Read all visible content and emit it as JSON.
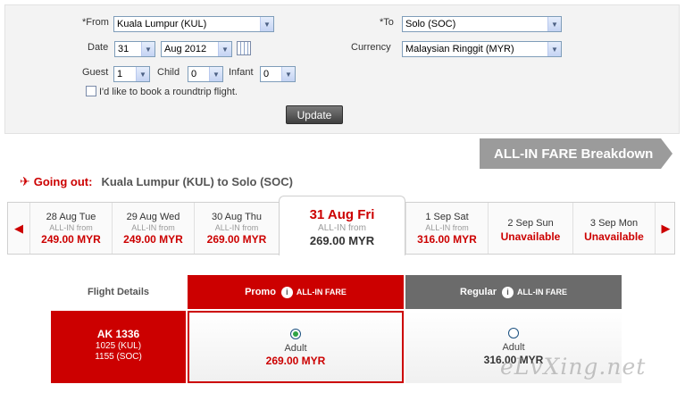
{
  "search": {
    "from_label": "*From",
    "from_value": "Kuala Lumpur (KUL)",
    "to_label": "*To",
    "to_value": "Solo (SOC)",
    "date_label": "Date",
    "date_day": "31",
    "date_month": "Aug 2012",
    "currency_label": "Currency",
    "currency_value": "Malaysian Ringgit (MYR)",
    "guest_label": "Guest",
    "guest_value": "1",
    "child_label": "Child",
    "child_value": "0",
    "infant_label": "Infant",
    "infant_value": "0",
    "roundtrip_label": "I'd like to book a roundtrip flight.",
    "update_label": "Update"
  },
  "breakdown_label": "ALL-IN FARE Breakdown",
  "going_out": {
    "label": "Going out:",
    "route": "Kuala Lumpur (KUL)  to  Solo (SOC)"
  },
  "dates": [
    {
      "date": "28 Aug Tue",
      "sub": "ALL-IN from",
      "price": "249.00 MYR"
    },
    {
      "date": "29 Aug Wed",
      "sub": "ALL-IN from",
      "price": "249.00 MYR"
    },
    {
      "date": "30 Aug Thu",
      "sub": "ALL-IN from",
      "price": "269.00 MYR"
    },
    {
      "date": "31 Aug Fri",
      "sub": "ALL-IN from",
      "price": "269.00 MYR"
    },
    {
      "date": "1 Sep Sat",
      "sub": "ALL-IN from",
      "price": "316.00 MYR"
    },
    {
      "date": "2 Sep Sun",
      "status": "Unavailable"
    },
    {
      "date": "3 Sep Mon",
      "status": "Unavailable"
    }
  ],
  "fares": {
    "flight_details_label": "Flight Details",
    "promo_title": "Promo",
    "promo_sub": "ALL-IN FARE",
    "regular_title": "Regular",
    "regular_sub": "ALL-IN FARE",
    "flight_no": "AK 1336",
    "depart": "1025 (KUL)",
    "arrive": "1155 (SOC)",
    "promo_type": "Adult",
    "promo_price": "269.00 MYR",
    "regular_type": "Adult",
    "regular_price": "316.00 MYR"
  },
  "watermark": "eLvXing.net",
  "colors": {
    "brand_red": "#cc0000",
    "regular_gray": "#6b6b6b",
    "breakdown_gray": "#9b9b9b"
  }
}
